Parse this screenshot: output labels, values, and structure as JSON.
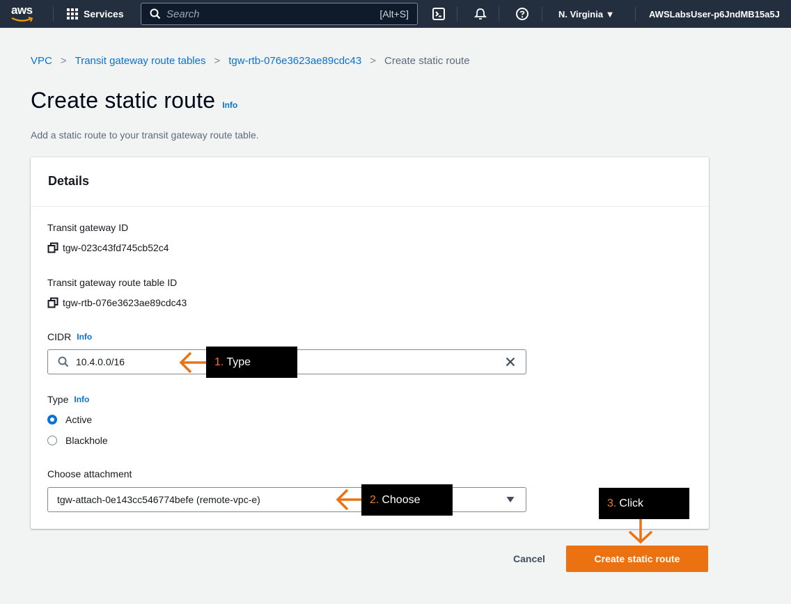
{
  "topbar": {
    "logo_text": "aws",
    "services_label": "Services",
    "search_placeholder": "Search",
    "search_shortcut": "[Alt+S]",
    "region_label": "N. Virginia ▼",
    "account_label": "AWSLabsUser-p6JndMB15a5J"
  },
  "breadcrumb": {
    "items": [
      "VPC",
      "Transit gateway route tables",
      "tgw-rtb-076e3623ae89cdc43"
    ],
    "current": "Create static route"
  },
  "page": {
    "title": "Create static route",
    "title_info": "Info",
    "description": "Add a static route to your transit gateway route table."
  },
  "details": {
    "header": "Details",
    "tgw_id_label": "Transit gateway ID",
    "tgw_id_value": "tgw-023c43fd745cb52c4",
    "rtb_id_label": "Transit gateway route table ID",
    "rtb_id_value": "tgw-rtb-076e3623ae89cdc43",
    "cidr_label": "CIDR",
    "cidr_info": "Info",
    "cidr_value": "10.4.0.0/16",
    "type_label": "Type",
    "type_info": "Info",
    "type_options": [
      "Active",
      "Blackhole"
    ],
    "type_selected": "Active",
    "attachment_label": "Choose attachment",
    "attachment_value": "tgw-attach-0e143cc546774befe (remote-vpc-e)"
  },
  "actions": {
    "cancel": "Cancel",
    "submit": "Create static route"
  },
  "annotations": {
    "step1_num": "1.",
    "step1_text": "Type",
    "step2_num": "2.",
    "step2_text": "Choose",
    "step3_num": "3.",
    "step3_text": "Click",
    "color": "#ec7211"
  }
}
